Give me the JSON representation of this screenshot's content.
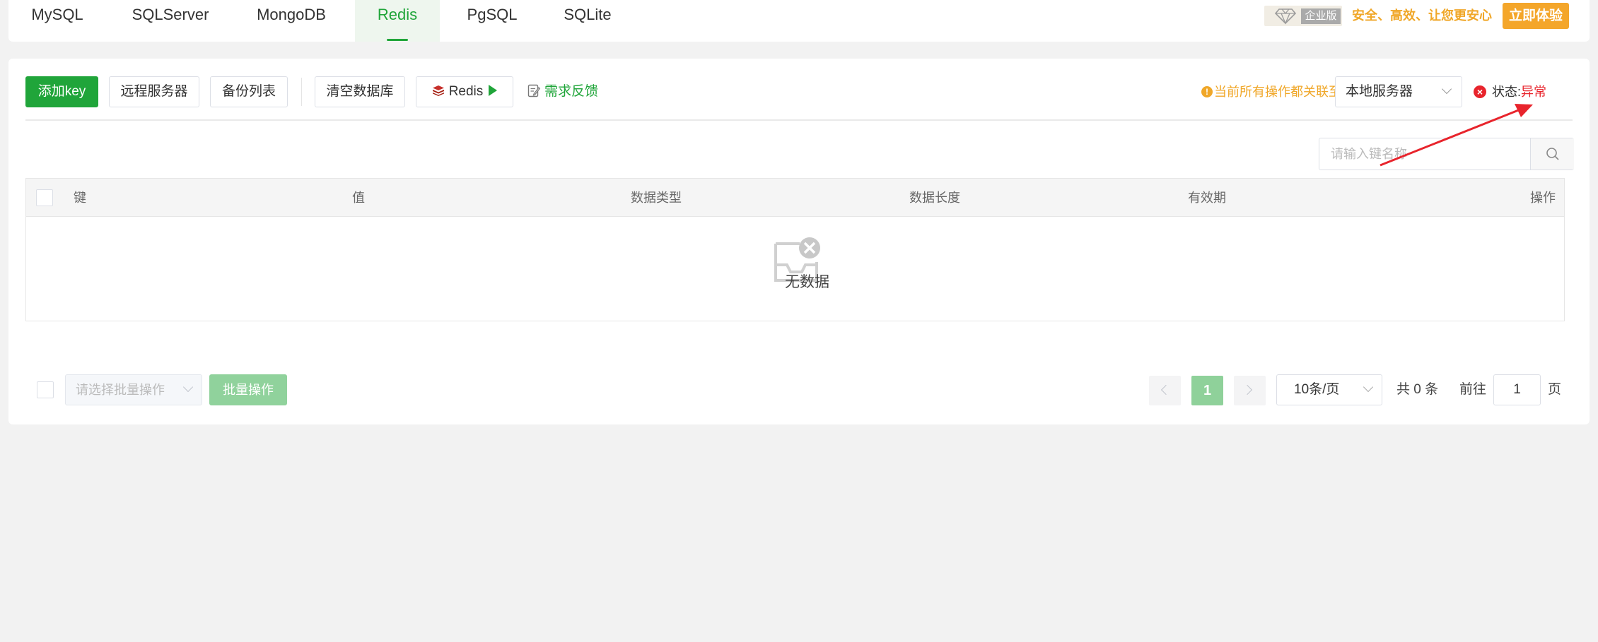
{
  "db_tabs": [
    {
      "label": "MySQL"
    },
    {
      "label": "SQLServer"
    },
    {
      "label": "MongoDB"
    },
    {
      "label": "Redis"
    },
    {
      "label": "PgSQL"
    },
    {
      "label": "SQLite"
    }
  ],
  "enterprise": {
    "badge_label": "企业版",
    "slogan": "安全、高效、让您更安心",
    "try_button": "立即体验"
  },
  "toolbar": {
    "add_key": "添加key",
    "remote_server": "远程服务器",
    "backup_list": "备份列表",
    "clear_db": "清空数据库",
    "redis_button": "Redis",
    "feedback": "需求反馈",
    "notice": "当前所有操作都关联至",
    "server_selected": "本地服务器",
    "status_label": "状态:",
    "status_value": "异常"
  },
  "search": {
    "placeholder": "请输入键名称"
  },
  "table": {
    "columns": [
      "键",
      "值",
      "数据类型",
      "数据长度",
      "有效期",
      "操作"
    ],
    "rows": [],
    "empty_text": "无数据"
  },
  "footer": {
    "batch_placeholder": "请选择批量操作",
    "batch_button": "批量操作",
    "current_page": "1",
    "page_size": "10条/页",
    "total": "共 0 条",
    "goto_label": "前往",
    "goto_value": "1",
    "page_unit": "页"
  },
  "colors": {
    "accent": "#20a53a",
    "warning": "#f0a728",
    "error": "#e8242c"
  }
}
